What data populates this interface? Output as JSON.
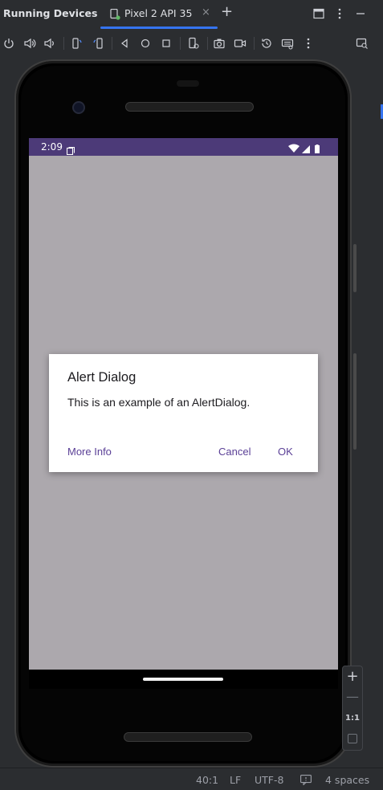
{
  "tool_window": {
    "title": "Running Devices"
  },
  "tabs": [
    {
      "label": "Pixel 2 API 35",
      "close_symbol": "×"
    }
  ],
  "add_tab_symbol": "+",
  "emulator": {
    "status_bar": {
      "time": "2:09"
    },
    "dialog": {
      "title": "Alert Dialog",
      "message": "This is an example of an AlertDialog.",
      "buttons": {
        "neutral": "More Info",
        "negative": "Cancel",
        "positive": "OK"
      }
    }
  },
  "zoom_controls": {
    "zoom_in": "+",
    "zoom_out": "—",
    "actual_size": "1:1"
  },
  "status_bar": {
    "caret_position": "40:1",
    "line_separator": "LF",
    "encoding": "UTF-8",
    "indent": "4 spaces"
  },
  "colors": {
    "ide_background": "#2b2d30",
    "tab_accent": "#3574f0",
    "android_status_bar": "#4c3a78",
    "scrim": "#aca8ad",
    "dialog_button": "#5a3f96"
  }
}
